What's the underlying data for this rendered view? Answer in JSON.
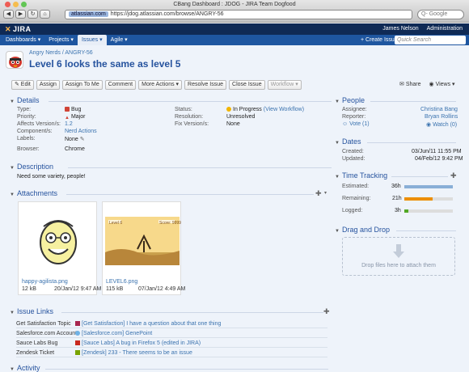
{
  "browser": {
    "window_title": "CBang Dashboard : JDOG - JIRA Team Dogfood",
    "back": "◀",
    "forward": "▶",
    "reload": "↻",
    "home": "⌂",
    "url_host": "atlassian.com",
    "url": "https://jdog.atlassian.com/browse/ANGRY-56",
    "search_placeholder": "Q- Google"
  },
  "header": {
    "logo": "JIRA",
    "user_name": "James Nelson",
    "admin": "Administration"
  },
  "nav": {
    "items": [
      {
        "label": "Dashboards ▾"
      },
      {
        "label": "Projects ▾"
      },
      {
        "label": "Issues ▾"
      },
      {
        "label": "Agile ▾"
      }
    ],
    "create": "+ Create Issue",
    "quick_search": "Quick Search"
  },
  "issue": {
    "project": "Angry Nerds",
    "key": "ANGRY-56",
    "summary": "Level 6 looks the same as level 5"
  },
  "toolbar": {
    "edit": "✎ Edit",
    "assign": "Assign",
    "assign_to_me": "Assign To Me",
    "comment": "Comment",
    "more_actions": "More Actions ▾",
    "resolve": "Resolve Issue",
    "close": "Close Issue",
    "workflow": "Workflow ▾",
    "share": "Share",
    "views": "Views ▾"
  },
  "details": {
    "heading": "Details",
    "type_label": "Type:",
    "type": "Bug",
    "priority_label": "Priority:",
    "priority": "Major",
    "affects_label": "Affects Version/s:",
    "affects": "1.2",
    "components_label": "Component/s:",
    "components": "Nerd Actions",
    "labels_label": "Labels:",
    "labels": "None",
    "browser_label": "Browser:",
    "browser": "Chrome",
    "status_label": "Status:",
    "status": "In Progress",
    "view_workflow": "(View Workflow)",
    "resolution_label": "Resolution:",
    "resolution": "Unresolved",
    "fix_label": "Fix Version/s:",
    "fix": "None"
  },
  "description": {
    "heading": "Description",
    "text": "Need some variety, people!"
  },
  "attachments": {
    "heading": "Attachments",
    "files": [
      {
        "name": "happy-agilista.png",
        "size": "12 kB",
        "date": "20/Jan/12 9:47 AM"
      },
      {
        "name": "LEVEL6.png",
        "size": "115 kB",
        "date": "07/Jan/12 4:49 AM"
      }
    ],
    "level_label": "Level 6",
    "score_label": "Score: 9999"
  },
  "issue_links": {
    "heading": "Issue Links",
    "rows": [
      {
        "type": "Get Satisfaction Topic",
        "text": "[Get Satisfaction] I have a question about that one thing"
      },
      {
        "type": "Salesforce.com Account",
        "text": "[Salesforce.com] GenePoint"
      },
      {
        "type": "Sauce Labs Bug",
        "text": "[Sauce Labs] A bug in Firefox 5 (edited in JIRA)"
      },
      {
        "type": "Zendesk Ticket",
        "text": "[Zendesk] 233 - There seems to be an issue"
      }
    ]
  },
  "activity": {
    "heading": "Activity"
  },
  "people": {
    "heading": "People",
    "assignee_label": "Assignee:",
    "assignee": "Christina Bang",
    "reporter_label": "Reporter:",
    "reporter": "Bryan Rollins",
    "vote": "Vote (1)",
    "watch": "Watch (0)"
  },
  "dates": {
    "heading": "Dates",
    "created_label": "Created:",
    "created": "03/Jun/11 11:55 PM",
    "updated_label": "Updated:",
    "updated": "04/Feb/12 9:42 PM"
  },
  "time_tracking": {
    "heading": "Time Tracking",
    "estimated_label": "Estimated:",
    "estimated": "36h",
    "estimated_fraction": 1.0,
    "remaining_label": "Remaining:",
    "remaining": "21h",
    "remaining_fraction": 0.58,
    "logged_label": "Logged:",
    "logged": "3h",
    "logged_fraction": 0.08
  },
  "drag_drop": {
    "heading": "Drag and Drop",
    "hint": "Drop files here to attach them"
  },
  "colors": {
    "header": "#0f2a55",
    "nav": "#1e56a0",
    "link": "#3b73af",
    "estimated": "#89afd7",
    "remaining": "#ec8e00",
    "logged": "#51a825"
  }
}
